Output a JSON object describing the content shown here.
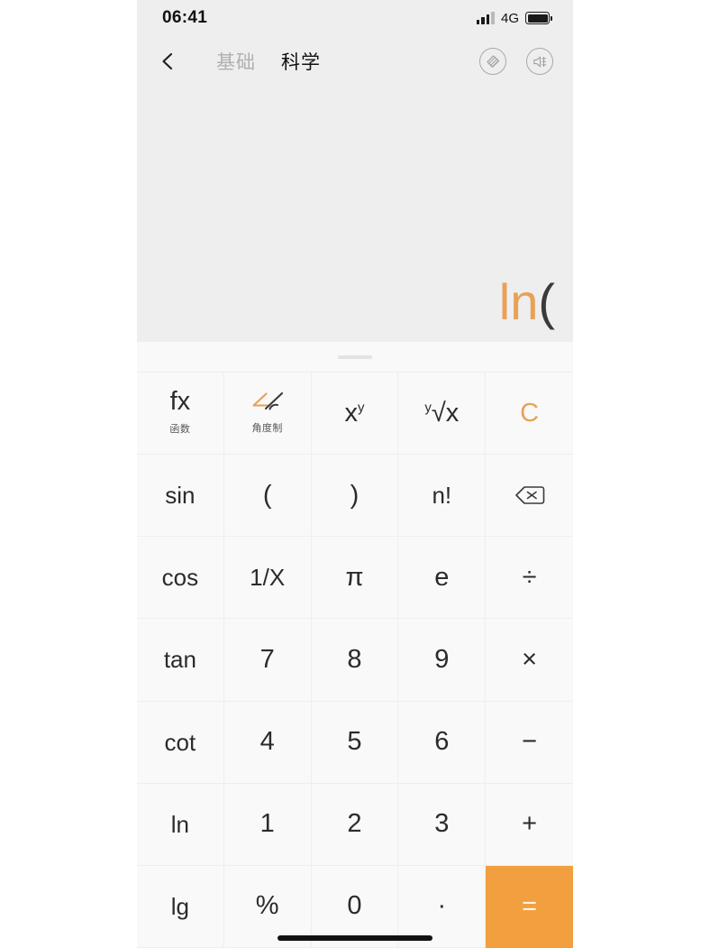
{
  "status_bar": {
    "time": "06:41",
    "network": "4G",
    "signal_icon": "signal-bars-icon",
    "battery_icon": "battery-full-icon"
  },
  "nav": {
    "back_icon": "back-arrow-icon",
    "tabs": [
      {
        "label": "基础",
        "active": false
      },
      {
        "label": "科学",
        "active": true
      }
    ],
    "actions": [
      {
        "icon": "theme-skin-icon",
        "label": ""
      },
      {
        "icon": "sound-off-icon",
        "label": ""
      }
    ]
  },
  "display": {
    "expression_fn": "ln",
    "expression_paren": "("
  },
  "keypad": {
    "drag_handle": "keypad-drag-handle",
    "colors": {
      "accent": "#e8a156",
      "equals_bg": "#f2a03f",
      "key_bg": "#f9f9f9",
      "display_bg": "#eeeeee"
    },
    "rows": [
      [
        {
          "label": "fx",
          "sub": "函数",
          "name": "key-fx"
        },
        {
          "label": "",
          "sub": "角度制",
          "name": "key-angle-mode",
          "icon": "angle-icon"
        },
        {
          "label": "x",
          "sup": "y",
          "name": "key-power"
        },
        {
          "label": "√x",
          "sup": "y",
          "name": "key-nth-root"
        },
        {
          "label": "C",
          "name": "key-clear",
          "accent": true
        }
      ],
      [
        {
          "label": "sin",
          "name": "key-sin"
        },
        {
          "label": "(",
          "name": "key-open-paren"
        },
        {
          "label": ")",
          "name": "key-close-paren"
        },
        {
          "label": "n!",
          "name": "key-factorial"
        },
        {
          "label": "",
          "name": "key-backspace",
          "icon": "backspace-icon"
        }
      ],
      [
        {
          "label": "cos",
          "name": "key-cos"
        },
        {
          "label": "1/X",
          "name": "key-reciprocal"
        },
        {
          "label": "π",
          "name": "key-pi"
        },
        {
          "label": "e",
          "name": "key-e"
        },
        {
          "label": "÷",
          "name": "key-divide"
        }
      ],
      [
        {
          "label": "tan",
          "name": "key-tan"
        },
        {
          "label": "7",
          "name": "key-7"
        },
        {
          "label": "8",
          "name": "key-8"
        },
        {
          "label": "9",
          "name": "key-9"
        },
        {
          "label": "×",
          "name": "key-multiply"
        }
      ],
      [
        {
          "label": "cot",
          "name": "key-cot"
        },
        {
          "label": "4",
          "name": "key-4"
        },
        {
          "label": "5",
          "name": "key-5"
        },
        {
          "label": "6",
          "name": "key-6"
        },
        {
          "label": "−",
          "name": "key-minus"
        }
      ],
      [
        {
          "label": "ln",
          "name": "key-ln"
        },
        {
          "label": "1",
          "name": "key-1"
        },
        {
          "label": "2",
          "name": "key-2"
        },
        {
          "label": "3",
          "name": "key-3"
        },
        {
          "label": "+",
          "name": "key-plus"
        }
      ],
      [
        {
          "label": "lg",
          "name": "key-lg"
        },
        {
          "label": "%",
          "name": "key-percent"
        },
        {
          "label": "0",
          "name": "key-0"
        },
        {
          "label": "·",
          "name": "key-decimal"
        },
        {
          "label": "=",
          "name": "key-equals",
          "equals": true
        }
      ]
    ]
  }
}
